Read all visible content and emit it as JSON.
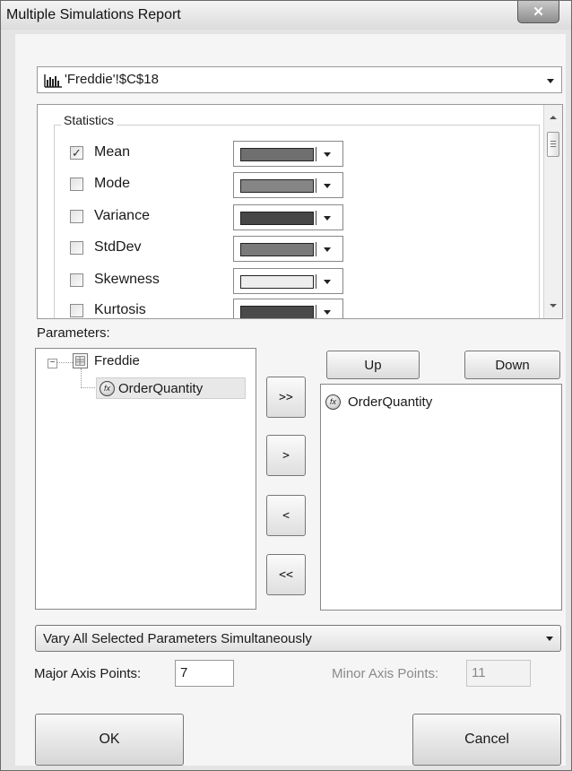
{
  "window": {
    "title": "Multiple Simulations Report",
    "close_glyph": "✕"
  },
  "cell": {
    "reference": "'Freddie'!$C$18",
    "icon": "range-chart-icon"
  },
  "statistics": {
    "group_label": "Statistics",
    "items": [
      {
        "label": "Mean",
        "checked": true,
        "check_glyph": "✓",
        "color": "#6f6f6f"
      },
      {
        "label": "Mode",
        "checked": false,
        "check_glyph": "",
        "color": "#858585"
      },
      {
        "label": "Variance",
        "checked": false,
        "check_glyph": "",
        "color": "#474747"
      },
      {
        "label": "StdDev",
        "checked": false,
        "check_glyph": "",
        "color": "#7a7a7a"
      },
      {
        "label": "Skewness",
        "checked": false,
        "check_glyph": "",
        "color": "#ededed"
      },
      {
        "label": "Kurtosis",
        "checked": false,
        "check_glyph": "",
        "color": "#4a4a4a"
      }
    ]
  },
  "parameters": {
    "label": "Parameters:",
    "tree": {
      "toggle_glyph": "−",
      "workbook": "Freddie",
      "child": "OrderQuantity",
      "icon_glyph": "fx"
    },
    "buttons": {
      "add_all": ">>",
      "add": ">",
      "remove": "<",
      "remove_all": "<<"
    },
    "up_label": "Up",
    "down_label": "Down",
    "selected": [
      "OrderQuantity"
    ]
  },
  "vary_mode": {
    "selected": "Vary All Selected Parameters Simultaneously"
  },
  "axis": {
    "major_label": "Major Axis Points:",
    "major_value": "7",
    "minor_label": "Minor Axis Points:",
    "minor_value": "11"
  },
  "footer": {
    "ok_label": "OK",
    "cancel_label": "Cancel"
  }
}
